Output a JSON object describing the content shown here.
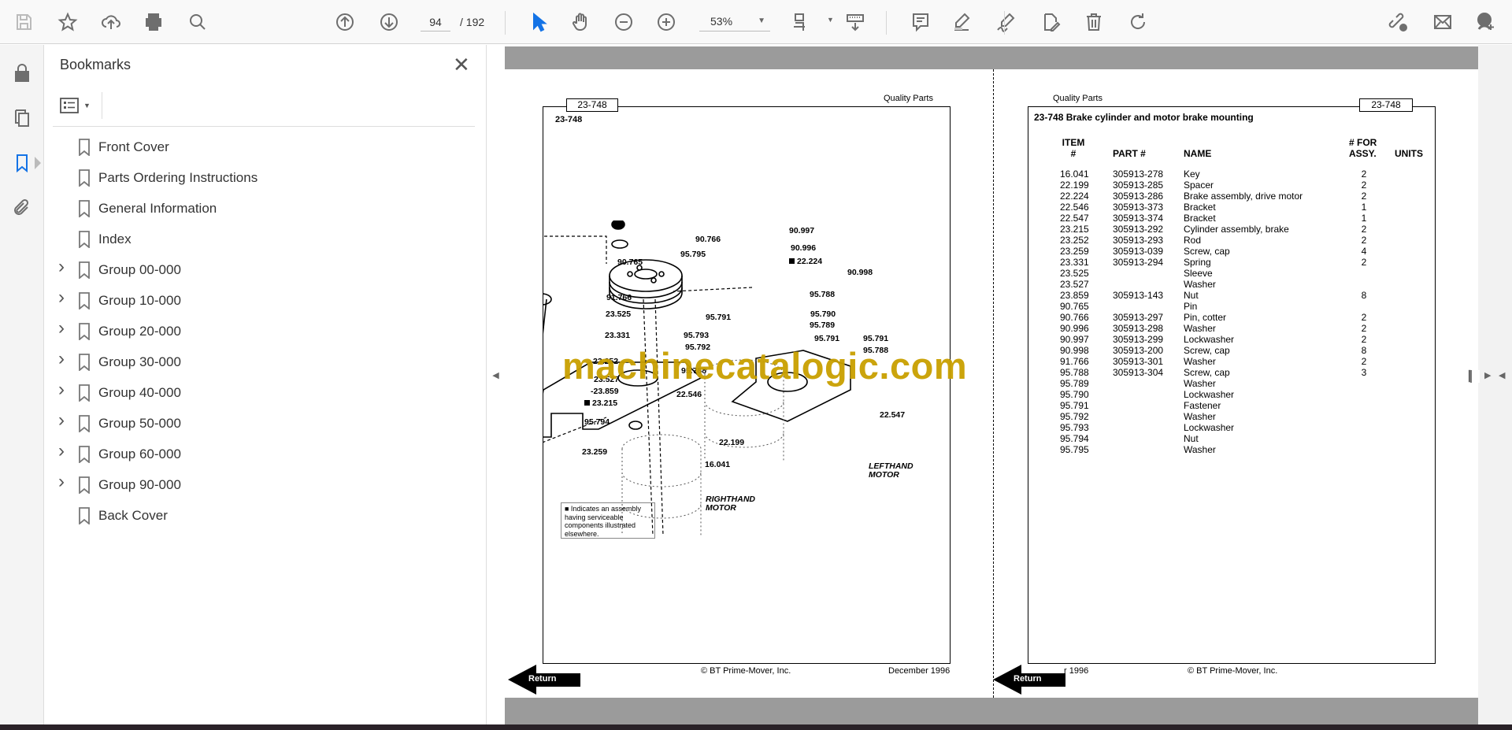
{
  "toolbar": {
    "icons": [
      "save-icon",
      "star-icon",
      "upload-icon",
      "print-icon",
      "find-icon",
      "page-up-icon",
      "page-down-icon",
      "select-icon",
      "hand-icon",
      "zoom-out-icon",
      "zoom-in-icon",
      "fit-page-icon",
      "scroll-mode-icon",
      "comment-icon",
      "highlight-icon",
      "sign-icon",
      "edit-icon",
      "delete-icon",
      "rotate-icon",
      "share-link-icon",
      "mail-icon",
      "account-icon"
    ],
    "page_current": "94",
    "page_total": "/ 192",
    "zoom": "53%",
    "accent": "#1473e6"
  },
  "rail": {
    "items": [
      "lock-icon",
      "pages-icon",
      "bookmarks-icon",
      "attachment-icon"
    ],
    "active": "bookmarks-icon"
  },
  "bookmarks": {
    "title": "Bookmarks",
    "items": [
      {
        "label": "Front Cover",
        "expandable": false
      },
      {
        "label": "Parts Ordering Instructions",
        "expandable": false
      },
      {
        "label": "General Information",
        "expandable": false
      },
      {
        "label": "Index",
        "expandable": false
      },
      {
        "label": "Group 00-000",
        "expandable": true
      },
      {
        "label": "Group 10-000",
        "expandable": true
      },
      {
        "label": "Group 20-000",
        "expandable": true
      },
      {
        "label": "Group 30-000",
        "expandable": true
      },
      {
        "label": "Group 40-000",
        "expandable": true
      },
      {
        "label": "Group 50-000",
        "expandable": true
      },
      {
        "label": "Group 60-000",
        "expandable": true
      },
      {
        "label": "Group 90-000",
        "expandable": true
      },
      {
        "label": "Back Cover",
        "expandable": false
      }
    ]
  },
  "left_page": {
    "tab": "23-748",
    "header": "Quality Parts",
    "figure_id": "23-748",
    "callouts": [
      "90.997",
      "90.766",
      "95.795",
      "90.996",
      "22.224",
      "90.765",
      "90.998",
      "95.788",
      "91.766",
      "95.791",
      "23.525",
      "95.790",
      "95.789",
      "95.793",
      "23.331",
      "95.792",
      "95.791",
      "95.791",
      "95.788",
      "23.252",
      "95.788",
      "23.527",
      "-23.859",
      "22.546",
      "23.215",
      "22.547",
      "95.794",
      "22.199",
      "23.259",
      "16.041"
    ],
    "lefthand_motor": "LEFTHAND MOTOR",
    "righthand_motor": "RIGHTHAND MOTOR",
    "legend": "■ Indicates an assembly having serviceable components illustrated elsewhere.",
    "copyright": "© BT Prime-Mover, Inc.",
    "date": "December 1996",
    "return": "Return"
  },
  "right_page": {
    "header": "Quality Parts",
    "tab": "23-748",
    "title": "23-748 Brake cylinder and motor brake mounting",
    "columns": {
      "item1": "ITEM",
      "item2": "#",
      "part": "PART #",
      "name": "NAME",
      "assy1": "# FOR",
      "assy2": "ASSY.",
      "units": "UNITS"
    },
    "rows": [
      [
        "16.041",
        "305913-278",
        "Key",
        "2"
      ],
      [
        "22.199",
        "305913-285",
        "Spacer",
        "2"
      ],
      [
        "22.224",
        "305913-286",
        "Brake assembly, drive motor",
        "2"
      ],
      [
        "22.546",
        "305913-373",
        "Bracket",
        "1"
      ],
      [
        "22.547",
        "305913-374",
        "Bracket",
        "1"
      ],
      [
        "23.215",
        "305913-292",
        "Cylinder assembly, brake",
        "2"
      ],
      [
        "23.252",
        "305913-293",
        "Rod",
        "2"
      ],
      [
        "23.259",
        "305913-039",
        "Screw, cap",
        "4"
      ],
      [
        "23.331",
        "305913-294",
        "Spring",
        "2"
      ],
      [
        "23.525",
        "",
        "Sleeve",
        ""
      ],
      [
        "23.527",
        "",
        "Washer",
        ""
      ],
      [
        "23.859",
        "305913-143",
        "Nut",
        "8"
      ],
      [
        "90.765",
        "",
        "Pin",
        ""
      ],
      [
        "90.766",
        "305913-297",
        "Pin, cotter",
        "2"
      ],
      [
        "90.996",
        "305913-298",
        "Washer",
        "2"
      ],
      [
        "90.997",
        "305913-299",
        "Lockwasher",
        "2"
      ],
      [
        "90.998",
        "305913-200",
        "Screw, cap",
        "8"
      ],
      [
        "91.766",
        "305913-301",
        "Washer",
        "2"
      ],
      [
        "95.788",
        "305913-304",
        "Screw, cap",
        "3"
      ],
      [
        "95.789",
        "",
        "Washer",
        ""
      ],
      [
        "95.790",
        "",
        "Lockwasher",
        ""
      ],
      [
        "95.791",
        "",
        "Fastener",
        ""
      ],
      [
        "95.792",
        "",
        "Washer",
        ""
      ],
      [
        "95.793",
        "",
        "Lockwasher",
        ""
      ],
      [
        "95.794",
        "",
        "Nut",
        ""
      ],
      [
        "95.795",
        "",
        "Washer",
        ""
      ]
    ],
    "date_partial": "r 1996",
    "copyright": "© BT Prime-Mover, Inc.",
    "return": "Return"
  },
  "watermark": "machinecatalogic.com",
  "watermark_color": "#c9a000"
}
